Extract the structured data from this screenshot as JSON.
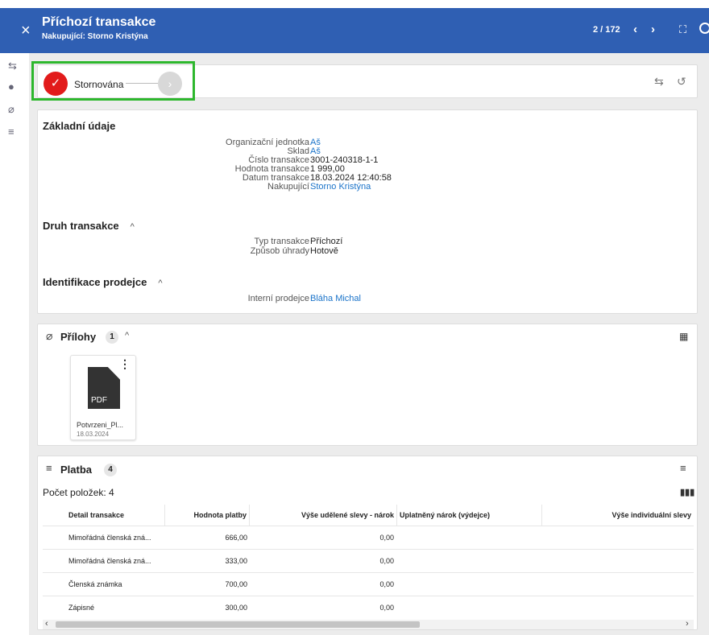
{
  "header": {
    "close_icon": "close-icon",
    "title": "Příchozí transakce",
    "subtitle": "Nakupující: Storno Kristýna",
    "pager": "2 / 172",
    "prev": "‹",
    "next": "›",
    "bg_color": "#2f5fb3"
  },
  "status": {
    "label": "Stornována",
    "check": "✓",
    "next_arrow": "›",
    "color_done": "#e21b1b",
    "highlight_color": "#2db72d"
  },
  "basic": {
    "title": "Základní údaje",
    "rows": [
      {
        "label": "Organizační jednotka",
        "value": "Aš",
        "link": true
      },
      {
        "label": "Sklad",
        "value": "Aš",
        "link": true
      },
      {
        "label": "Číslo transakce",
        "value": "3001-240318-1-1",
        "link": false
      },
      {
        "label": "Hodnota transakce",
        "value": "1 999,00",
        "link": false
      },
      {
        "label": "Datum transakce",
        "value": "18.03.2024 12:40:58",
        "link": false
      },
      {
        "label": "Nakupující",
        "value": "Storno Kristýna",
        "link": true
      }
    ]
  },
  "druh": {
    "title": "Druh transakce",
    "caret": "^",
    "rows": [
      {
        "label": "Typ transakce",
        "value": "Příchozí"
      },
      {
        "label": "Způsob úhrady",
        "value": "Hotově"
      }
    ]
  },
  "ident": {
    "title": "Identifikace prodejce",
    "caret": "^",
    "rows": [
      {
        "label": "Interní prodejce",
        "value": "Bláha Michal"
      }
    ]
  },
  "attachments": {
    "title": "Přílohy",
    "count": "1",
    "caret": "^",
    "file": {
      "type": "PDF",
      "name": "Potvrzeni_Pl...",
      "date": "18.03.2024"
    }
  },
  "payment": {
    "title": "Platba",
    "count": "4",
    "items_count": "Počet položek: 4",
    "columns": [
      "Detail transakce",
      "Hodnota platby",
      "Výše udělené slevy - nárok",
      "Uplatněný nárok (výdejce)",
      "Výše individuální slevy"
    ],
    "rows": [
      {
        "detail": "Mimořádná členská zná...",
        "value": "666,00",
        "discount": "0,00"
      },
      {
        "detail": "Mimořádná členská zná...",
        "value": "333,00",
        "discount": "0,00"
      },
      {
        "detail": "Členská známka",
        "value": "700,00",
        "discount": "0,00"
      },
      {
        "detail": "Zápisné",
        "value": "300,00",
        "discount": "0,00"
      }
    ]
  }
}
